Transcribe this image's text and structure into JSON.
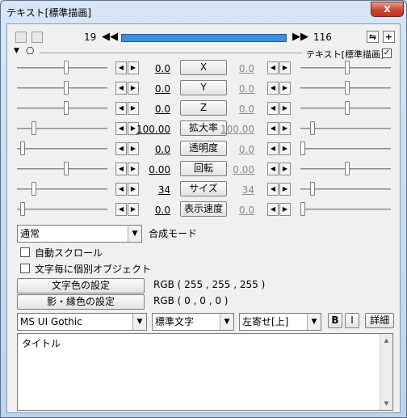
{
  "window": {
    "title": "テキスト[標準描画]",
    "close_label": "x"
  },
  "toolbar": {
    "start_frame": "19",
    "end_frame": "116",
    "prev_arrow": "◀◀",
    "next_arrow": "▶▶",
    "loop_btn": "⇋",
    "add_btn": "+"
  },
  "header": {
    "caption": "テキスト[標準描画]",
    "checked": "✓"
  },
  "params": [
    {
      "name": "X",
      "left_value": "0.0",
      "right_value": "0.0"
    },
    {
      "name": "Y",
      "left_value": "0.0",
      "right_value": "0.0"
    },
    {
      "name": "Z",
      "left_value": "0.0",
      "right_value": "0.0"
    },
    {
      "name": "拡大率",
      "left_value": "100.00",
      "right_value": "100.00"
    },
    {
      "name": "透明度",
      "left_value": "0.0",
      "right_value": "0.0"
    },
    {
      "name": "回転",
      "left_value": "0.00",
      "right_value": "0.00"
    },
    {
      "name": "サイズ",
      "left_value": "34",
      "right_value": "34"
    },
    {
      "name": "表示速度",
      "left_value": "0.0",
      "right_value": "0.0"
    }
  ],
  "blend": {
    "selected": "通常",
    "label": "合成モード"
  },
  "options": {
    "auto_scroll": "自動スクロール",
    "per_char_object": "文字毎に個別オブジェクト"
  },
  "colors": {
    "text_color_button": "文字色の設定",
    "text_color_value": "RGB ( 255 , 255 , 255 )",
    "shadow_color_button": "影・縁色の設定",
    "shadow_color_value": "RGB ( 0 , 0 , 0 )"
  },
  "font": {
    "family": "MS UI Gothic",
    "style": "標準文字",
    "align": "左寄せ[上]",
    "bold": "B",
    "italic": "I",
    "detail": "詳細"
  },
  "text_content": "タイトル",
  "icons": {
    "step_left": "◀",
    "step_right": "▶",
    "dropdown": "▼",
    "scroll_up": "▲",
    "scroll_down": "▼"
  },
  "accent_color": "#3a8ee6"
}
